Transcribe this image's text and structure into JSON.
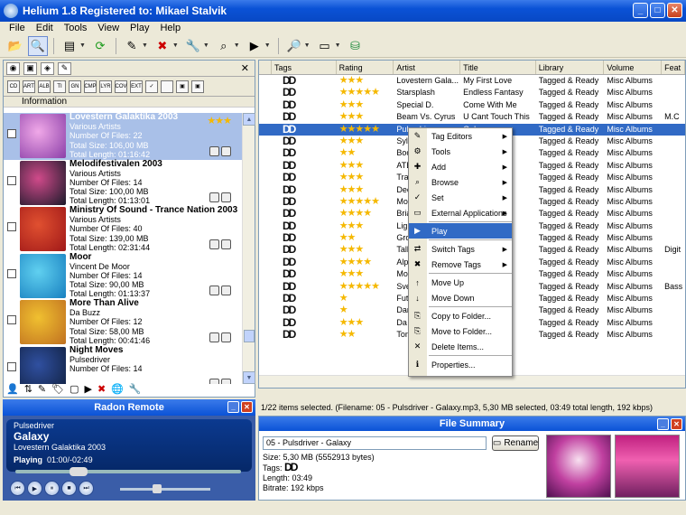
{
  "window": {
    "title": "Helium 1.8 Registered to: Mikael Stalvik"
  },
  "menu": [
    "File",
    "Edit",
    "Tools",
    "View",
    "Play",
    "Help"
  ],
  "left": {
    "info_header": "Information",
    "albums": [
      {
        "title": "Lovestern Galaktika 2003",
        "artist": "Various Artists",
        "files": "Number Of Files: 22",
        "size": "Total Size: 106,00 MB",
        "length": "Total Length: 01:16:42",
        "stars": "★★★",
        "selected": true,
        "colors": [
          "#8b3fa8",
          "#f0a8e8"
        ]
      },
      {
        "title": "Melodifestivalen 2003",
        "artist": "Various Artists",
        "files": "Number Of Files: 14",
        "size": "Total Size: 100,00 MB",
        "length": "Total Length: 01:13:01",
        "stars": "",
        "selected": false,
        "colors": [
          "#1a1a2a",
          "#d04a8a"
        ]
      },
      {
        "title": "Ministry Of Sound - Trance Nation 2003",
        "artist": "Various Artists",
        "files": "Number Of Files: 40",
        "size": "Total Size: 139,00 MB",
        "length": "Total Length: 02:31:44",
        "stars": "",
        "selected": false,
        "colors": [
          "#a01818",
          "#e05030"
        ]
      },
      {
        "title": "Moor",
        "artist": "Vincent De Moor",
        "files": "Number Of Files: 14",
        "size": "Total Size: 90,00 MB",
        "length": "Total Length: 01:13:37",
        "stars": "",
        "selected": false,
        "colors": [
          "#1880c0",
          "#60d0f0"
        ]
      },
      {
        "title": "More Than Alive",
        "artist": "Da Buzz",
        "files": "Number Of Files: 12",
        "size": "Total Size: 58,00 MB",
        "length": "Total Length: 00:41:46",
        "stars": "",
        "selected": false,
        "colors": [
          "#c07020",
          "#f0c030"
        ]
      },
      {
        "title": "Night Moves",
        "artist": "Pulsedriver",
        "files": "Number Of Files: 14",
        "size": "",
        "length": "",
        "stars": "",
        "selected": false,
        "colors": [
          "#102040",
          "#3050a0"
        ]
      }
    ]
  },
  "radon": {
    "header": "Radon Remote",
    "artist": "Pulsedriver",
    "title": "Galaxy",
    "album": "Lovestern Galaktika 2003",
    "state": "Playing",
    "time": "01:00/-02:49"
  },
  "columns": [
    "Tags",
    "Rating",
    "Artist",
    "Title",
    "Library",
    "Volume",
    "Feat"
  ],
  "rows": [
    {
      "stars": "★★★",
      "artist": "Lovestern Gala...",
      "title": "My First Love",
      "lib": "Tagged & Ready",
      "vol": "Misc Albums",
      "feat": ""
    },
    {
      "stars": "★★★★★",
      "artist": "Starsplash",
      "title": "Endless Fantasy",
      "lib": "Tagged & Ready",
      "vol": "Misc Albums",
      "feat": ""
    },
    {
      "stars": "★★★",
      "artist": "Special D.",
      "title": "Come With Me",
      "lib": "Tagged & Ready",
      "vol": "Misc Albums",
      "feat": ""
    },
    {
      "stars": "★★★",
      "artist": "Beam Vs. Cyrus",
      "title": "U Cant Touch This",
      "lib": "Tagged & Ready",
      "vol": "Misc Albums",
      "feat": "M.C"
    },
    {
      "stars": "★★★★★",
      "artist": "Pulsedriver",
      "title": "Galaxy",
      "lib": "Tagged & Ready",
      "vol": "Misc Albums",
      "feat": "",
      "sel": true
    },
    {
      "stars": "★★★",
      "artist": "Syl",
      "title": "",
      "lib": "Tagged & Ready",
      "vol": "Misc Albums",
      "feat": ""
    },
    {
      "stars": "★★",
      "artist": "Boo",
      "title": "ove",
      "lib": "Tagged & Ready",
      "vol": "Misc Albums",
      "feat": ""
    },
    {
      "stars": "★★★",
      "artist": "ATE",
      "title": "top",
      "lib": "Tagged & Ready",
      "vol": "Misc Albums",
      "feat": ""
    },
    {
      "stars": "★★★",
      "artist": "Tra",
      "title": "",
      "lib": "Tagged & Ready",
      "vol": "Misc Albums",
      "feat": ""
    },
    {
      "stars": "★★★",
      "artist": "Dee",
      "title": "am",
      "lib": "Tagged & Ready",
      "vol": "Misc Albums",
      "feat": ""
    },
    {
      "stars": "★★★★★",
      "artist": "Mo",
      "title": "Yo...",
      "lib": "Tagged & Ready",
      "vol": "Misc Albums",
      "feat": ""
    },
    {
      "stars": "★★★★",
      "artist": "Bria",
      "title": "",
      "lib": "Tagged & Ready",
      "vol": "Misc Albums",
      "feat": ""
    },
    {
      "stars": "★★★",
      "artist": "Ligh",
      "title": "ry",
      "lib": "Tagged & Ready",
      "vol": "Misc Albums",
      "feat": ""
    },
    {
      "stars": "★★",
      "artist": "Gro",
      "title": "",
      "lib": "Tagged & Ready",
      "vol": "Misc Albums",
      "feat": ""
    },
    {
      "stars": "★★★",
      "artist": "Tall",
      "title": "",
      "lib": "Tagged & Ready",
      "vol": "Misc Albums",
      "feat": "Digit"
    },
    {
      "stars": "★★★★",
      "artist": "Alp",
      "title": "",
      "lib": "Tagged & Ready",
      "vol": "Misc Albums",
      "feat": ""
    },
    {
      "stars": "★★★",
      "artist": "Mod",
      "title": "",
      "lib": "Tagged & Ready",
      "vol": "Misc Albums",
      "feat": ""
    },
    {
      "stars": "★★★★★",
      "artist": "Sve",
      "title": "",
      "lib": "Tagged & Ready",
      "vol": "Misc Albums",
      "feat": "Bass"
    },
    {
      "stars": "★",
      "artist": "Fut",
      "title": "",
      "lib": "Tagged & Ready",
      "vol": "Misc Albums",
      "feat": ""
    },
    {
      "stars": "★",
      "artist": "Dar",
      "title": "",
      "lib": "Tagged & Ready",
      "vol": "Misc Albums",
      "feat": ""
    },
    {
      "stars": "★★★",
      "artist": "Da",
      "title": "",
      "lib": "Tagged & Ready",
      "vol": "Misc Albums",
      "feat": ""
    },
    {
      "stars": "★★",
      "artist": "Ton",
      "title": "",
      "lib": "Tagged & Ready",
      "vol": "Misc Albums",
      "feat": ""
    }
  ],
  "context_menu": [
    {
      "label": "Tag Editors",
      "icon": "✎",
      "sub": true
    },
    {
      "label": "Tools",
      "icon": "⚙",
      "sub": true
    },
    {
      "label": "Add",
      "icon": "✚",
      "sub": true
    },
    {
      "label": "Browse",
      "icon": "⌕",
      "sub": true
    },
    {
      "label": "Set",
      "icon": "✓",
      "sub": true
    },
    {
      "label": "External Applications",
      "icon": "▭",
      "sub": true,
      "sep": true
    },
    {
      "label": "Play",
      "icon": "▶",
      "hl": true,
      "sep": true
    },
    {
      "label": "Switch Tags",
      "icon": "⇄",
      "sub": true
    },
    {
      "label": "Remove Tags",
      "icon": "✖",
      "sub": true,
      "sep": true
    },
    {
      "label": "Move Up",
      "icon": "↑"
    },
    {
      "label": "Move Down",
      "icon": "↓",
      "sep": true
    },
    {
      "label": "Copy to Folder...",
      "icon": "⎘"
    },
    {
      "label": "Move to Folder...",
      "icon": "⎘"
    },
    {
      "label": "Delete Items...",
      "icon": "✕",
      "sep": true
    },
    {
      "label": "Properties...",
      "icon": "ℹ"
    }
  ],
  "status": "1/22 items selected. (Filename: 05 - Pulsdriver - Galaxy.mp3, 5,30 MB selected, 03:49 total length, 192 kbps)",
  "file_summary": {
    "header": "File Summary",
    "filename": "05 - Pulsdriver - Galaxy",
    "rename": "Rename",
    "size": "Size: 5,30 MB (5552913 bytes)",
    "tags": "Tags:",
    "tag_mark": "DD",
    "length": "Length: 03:49",
    "bitrate": "Bitrate: 192 kbps"
  },
  "tag_mark": "DD"
}
